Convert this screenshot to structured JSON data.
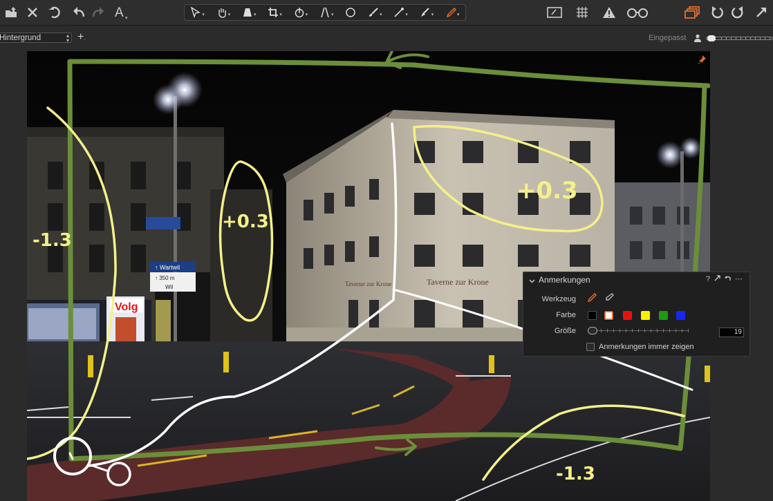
{
  "toolbar": {
    "left_tools": [
      "import-icon",
      "delete-icon",
      "undo-history-icon",
      "undo-icon",
      "redo-icon",
      "text-icon"
    ],
    "center_tools": [
      "select-icon",
      "pan-icon",
      "perspective-icon",
      "crop-icon",
      "rotate-icon",
      "keystone-icon",
      "circle-icon",
      "brush-icon",
      "eyedropper-icon",
      "fill-icon",
      "annotate-pen-icon"
    ],
    "right_tools": [
      "edit-mask-icon",
      "grid-icon",
      "warning-icon",
      "glasses-icon",
      "stack-icon",
      "rotate-left-icon",
      "rotate-right-icon",
      "expand-icon"
    ]
  },
  "subbar": {
    "layer_name": "Hintergrund",
    "zoom_label": "Eingepasst"
  },
  "annotations_overlay": {
    "labels": [
      "-1.3",
      "+0.3",
      "+0.3",
      "-1.3"
    ]
  },
  "panel": {
    "title": "Anmerkungen",
    "tool_label": "Werkzeug",
    "color_label": "Farbe",
    "size_label": "Größe",
    "size_value": "19",
    "always_show_label": "Anmerkungen immer zeigen",
    "colors": [
      "#000000",
      "#ffffff",
      "#e8120c",
      "#f6f000",
      "#1b9a14",
      "#1428f0"
    ],
    "selected_color": "#ffffff"
  },
  "accent_color": "#e8702a"
}
